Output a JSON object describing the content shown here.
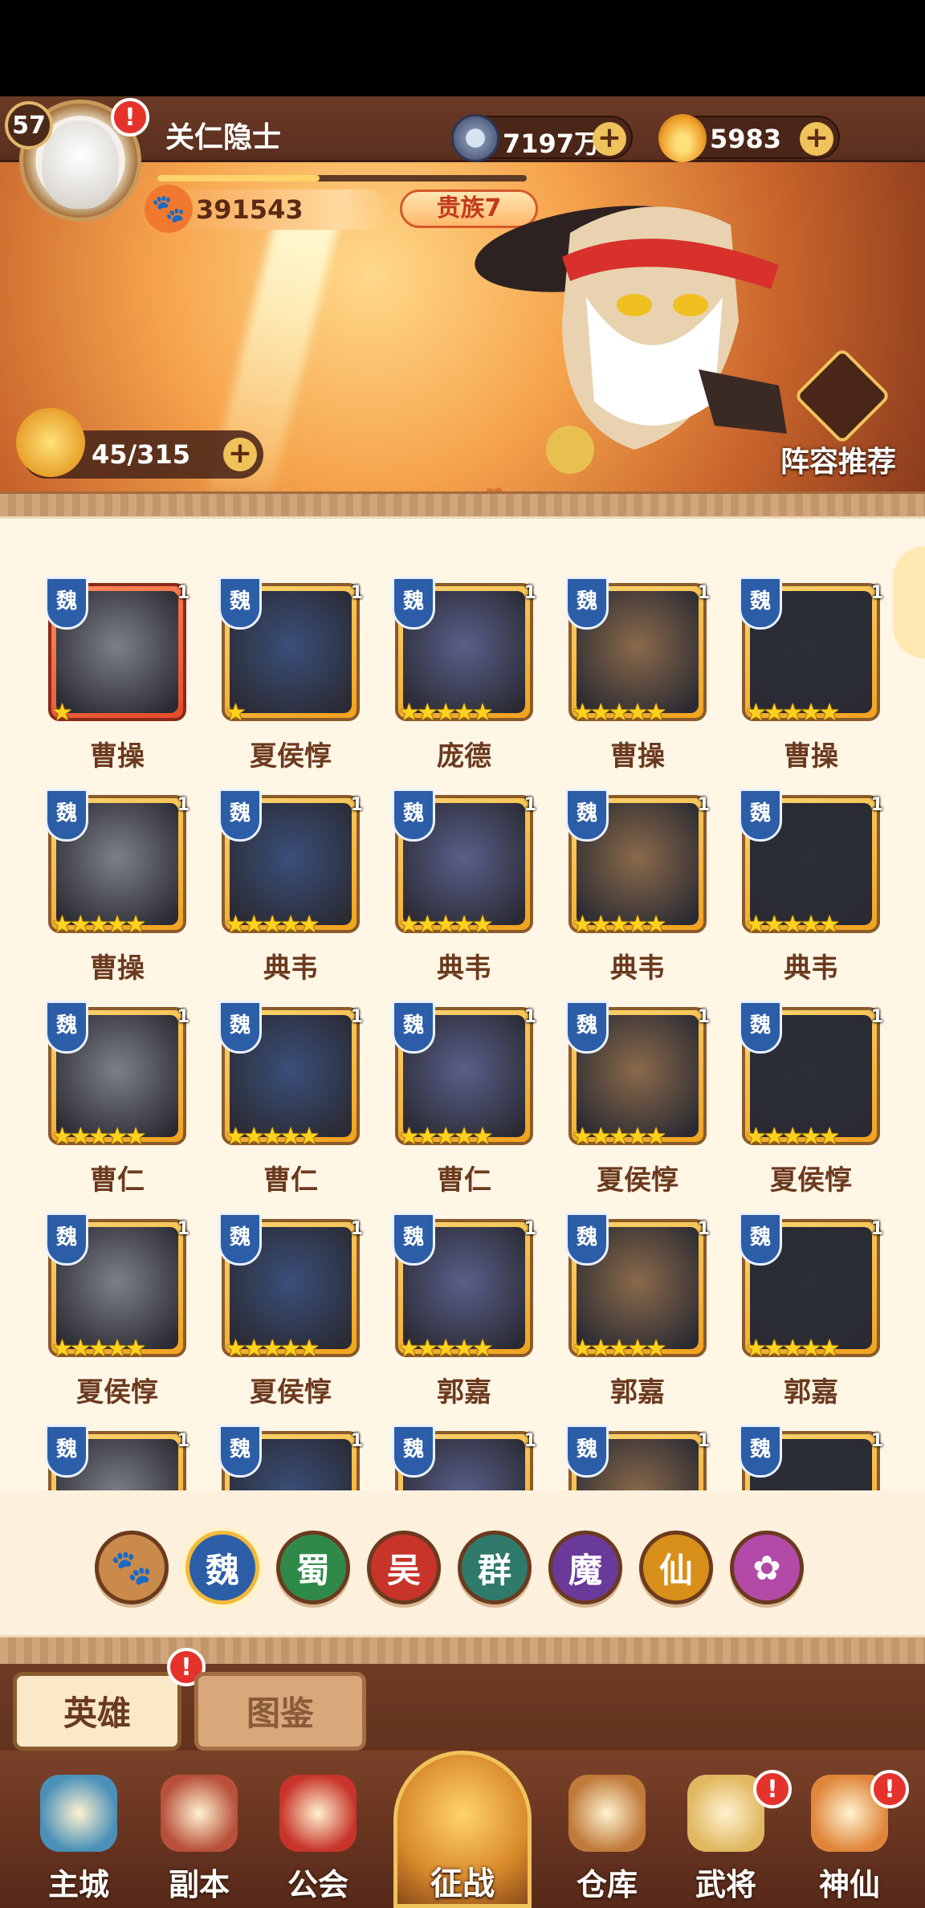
{
  "player": {
    "level": "57",
    "name": "关仁隐士",
    "power": "391543",
    "vip": "贵族7",
    "exp_fraction": 0.44
  },
  "currencies": {
    "coins": "7197万",
    "gold": "5983",
    "plus_glyph": "+"
  },
  "stamina": {
    "value": "45/315"
  },
  "lineup_button": {
    "label": "阵容推荐"
  },
  "alert_glyph": "!",
  "heroes": [
    {
      "name": "曹操",
      "faction": "魏",
      "level": "1",
      "stars": "★",
      "frame": "red"
    },
    {
      "name": "夏侯惇",
      "faction": "魏",
      "level": "1",
      "stars": "★",
      "frame": "gold"
    },
    {
      "name": "庞德",
      "faction": "魏",
      "level": "1",
      "stars": "★★★★★",
      "frame": "gold"
    },
    {
      "name": "曹操",
      "faction": "魏",
      "level": "1",
      "stars": "★★★★★",
      "frame": "gold"
    },
    {
      "name": "曹操",
      "faction": "魏",
      "level": "1",
      "stars": "★★★★★",
      "frame": "gold"
    },
    {
      "name": "曹操",
      "faction": "魏",
      "level": "1",
      "stars": "★★★★★",
      "frame": "gold"
    },
    {
      "name": "典韦",
      "faction": "魏",
      "level": "1",
      "stars": "★★★★★",
      "frame": "gold"
    },
    {
      "name": "典韦",
      "faction": "魏",
      "level": "1",
      "stars": "★★★★★",
      "frame": "gold"
    },
    {
      "name": "典韦",
      "faction": "魏",
      "level": "1",
      "stars": "★★★★★",
      "frame": "gold"
    },
    {
      "name": "典韦",
      "faction": "魏",
      "level": "1",
      "stars": "★★★★★",
      "frame": "gold"
    },
    {
      "name": "曹仁",
      "faction": "魏",
      "level": "1",
      "stars": "★★★★★",
      "frame": "gold"
    },
    {
      "name": "曹仁",
      "faction": "魏",
      "level": "1",
      "stars": "★★★★★",
      "frame": "gold"
    },
    {
      "name": "曹仁",
      "faction": "魏",
      "level": "1",
      "stars": "★★★★★",
      "frame": "gold"
    },
    {
      "name": "夏侯惇",
      "faction": "魏",
      "level": "1",
      "stars": "★★★★★",
      "frame": "gold"
    },
    {
      "name": "夏侯惇",
      "faction": "魏",
      "level": "1",
      "stars": "★★★★★",
      "frame": "gold"
    },
    {
      "name": "夏侯惇",
      "faction": "魏",
      "level": "1",
      "stars": "★★★★★",
      "frame": "gold"
    },
    {
      "name": "夏侯惇",
      "faction": "魏",
      "level": "1",
      "stars": "★★★★★",
      "frame": "gold"
    },
    {
      "name": "郭嘉",
      "faction": "魏",
      "level": "1",
      "stars": "★★★★★",
      "frame": "gold"
    },
    {
      "name": "郭嘉",
      "faction": "魏",
      "level": "1",
      "stars": "★★★★★",
      "frame": "gold"
    },
    {
      "name": "郭嘉",
      "faction": "魏",
      "level": "1",
      "stars": "★★★★★",
      "frame": "gold"
    },
    {
      "name": "",
      "faction": "魏",
      "level": "1",
      "stars": "",
      "frame": "gold"
    },
    {
      "name": "",
      "faction": "魏",
      "level": "1",
      "stars": "",
      "frame": "gold"
    },
    {
      "name": "",
      "faction": "魏",
      "level": "1",
      "stars": "",
      "frame": "gold"
    },
    {
      "name": "",
      "faction": "魏",
      "level": "1",
      "stars": "",
      "frame": "gold"
    },
    {
      "name": "",
      "faction": "魏",
      "level": "1",
      "stars": "",
      "frame": "gold"
    }
  ],
  "filters": [
    {
      "label": "🐾",
      "icon": "paw-icon",
      "color": "#c98a4a",
      "active": false
    },
    {
      "label": "魏",
      "icon": "wei-faction",
      "color": "#2c5ea8",
      "active": true
    },
    {
      "label": "蜀",
      "icon": "shu-faction",
      "color": "#2f8a4a",
      "active": false
    },
    {
      "label": "吴",
      "icon": "wu-faction",
      "color": "#c8342a",
      "active": false
    },
    {
      "label": "群",
      "icon": "qun-faction",
      "color": "#2f7a6a",
      "active": false
    },
    {
      "label": "魔",
      "icon": "mo-faction",
      "color": "#6a3a9a",
      "active": false
    },
    {
      "label": "仙",
      "icon": "xian-faction",
      "color": "#d8901a",
      "active": false
    },
    {
      "label": "✿",
      "icon": "spirit-icon",
      "color": "#b34aa8",
      "active": false
    }
  ],
  "tabs": {
    "heroes": "英雄",
    "codex": "图鉴"
  },
  "nav": [
    {
      "label": "主城",
      "icon": "main-city-icon",
      "color": "#4a90b8"
    },
    {
      "label": "副本",
      "icon": "dungeon-icon",
      "color": "#b8503a"
    },
    {
      "label": "公会",
      "icon": "guild-icon",
      "color": "#c8342a"
    },
    {
      "label": "征战",
      "icon": "campaign-icon",
      "color": "#e0a030"
    },
    {
      "label": "仓库",
      "icon": "warehouse-icon",
      "color": "#c07a3a"
    },
    {
      "label": "武将",
      "icon": "generals-icon",
      "color": "#e0b860"
    },
    {
      "label": "神仙",
      "icon": "immortal-icon",
      "color": "#e0863a"
    }
  ]
}
